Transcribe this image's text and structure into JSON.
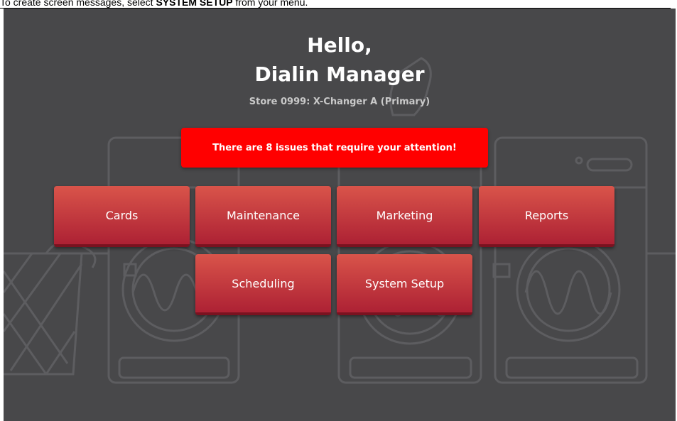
{
  "instruction": {
    "prefix": "To create screen messages, select ",
    "emphasis": "SYSTEM SETUP",
    "suffix": " from your menu."
  },
  "greeting": {
    "line1": "Hello,",
    "line2": "Dialin Manager"
  },
  "store_label": "Store 0999: X-Changer A (Primary)",
  "alert": {
    "text": "There are 8 issues that require your attention!",
    "color": "#ff0000"
  },
  "menu": {
    "cards": "Cards",
    "maintenance": "Maintenance",
    "marketing": "Marketing",
    "reports": "Reports",
    "scheduling": "Scheduling",
    "system_setup": "System Setup"
  },
  "colors": {
    "background": "#48484a",
    "button_top": "#d9544a",
    "button_bottom": "#ad2134"
  }
}
